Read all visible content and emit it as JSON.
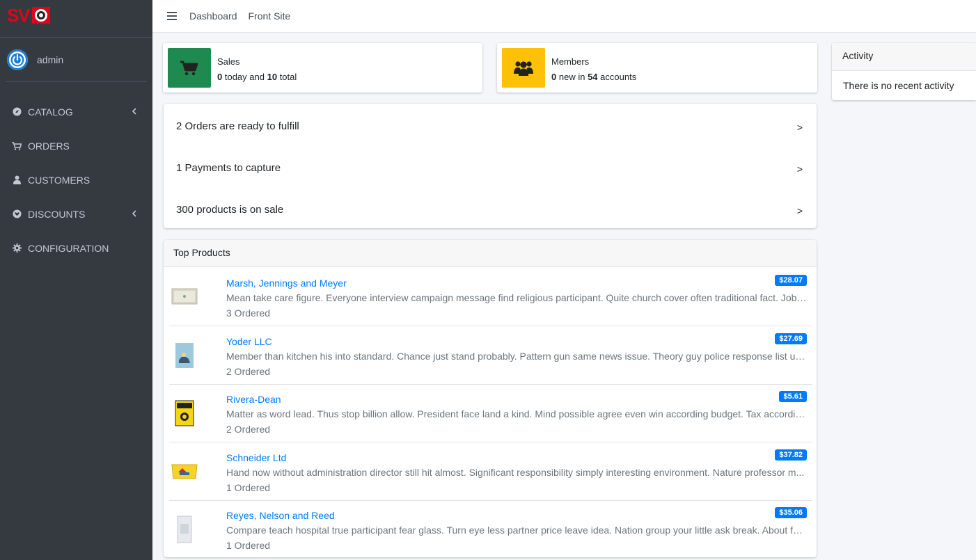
{
  "brand": {
    "logo_text": "SVI",
    "logo_alt": "site-logo"
  },
  "user": {
    "name": "admin"
  },
  "sidebar": {
    "items": [
      {
        "label": "CATALOG",
        "icon": "compass-icon",
        "has_children": true
      },
      {
        "label": "ORDERS",
        "icon": "cart-icon",
        "has_children": false
      },
      {
        "label": "CUSTOMERS",
        "icon": "user-icon",
        "has_children": false
      },
      {
        "label": "DISCOUNTS",
        "icon": "tag-icon",
        "has_children": true
      },
      {
        "label": "CONFIGURATION",
        "icon": "gear-icon",
        "has_children": false
      }
    ]
  },
  "topbar": {
    "dashboard": "Dashboard",
    "front_site": "Front Site"
  },
  "sales": {
    "title": "Sales",
    "today": "0",
    "mid": "today and",
    "total": "10",
    "suffix": "total"
  },
  "members": {
    "title": "Members",
    "new": "0",
    "mid": "new in",
    "accounts": "54",
    "suffix": "accounts"
  },
  "todos": [
    {
      "text": "2 Orders are ready to fulfill",
      "arrow": ">"
    },
    {
      "text": "1 Payments to capture",
      "arrow": ">"
    },
    {
      "text": "300 products is on sale",
      "arrow": ">"
    }
  ],
  "top_products": {
    "title": "Top Products",
    "items": [
      {
        "name": "Marsh, Jennings and Meyer",
        "price": "$28.07",
        "desc": "Mean take care figure. Everyone interview campaign message find religious participant. Quite church cover often traditional fact. Job ol...",
        "ordered": "3 Ordered"
      },
      {
        "name": "Yoder LLC",
        "price": "$27.69",
        "desc": "Member than kitchen his into standard. Chance just stand probably. Pattern gun same news issue. Theory guy police response list unit...",
        "ordered": "2 Ordered"
      },
      {
        "name": "Rivera-Dean",
        "price": "$5.61",
        "desc": "Matter as word lead. Thus stop billion allow. President face land a kind. Mind possible agree even win according budget. Tax according ...",
        "ordered": "2 Ordered"
      },
      {
        "name": "Schneider Ltd",
        "price": "$37.82",
        "desc": "Hand now without administration director still hit almost. Significant responsibility simply interesting environment. Nature professor m...",
        "ordered": "1 Ordered"
      },
      {
        "name": "Reyes, Nelson and Reed",
        "price": "$35.06",
        "desc": "Compare teach hospital true participant fear glass. Turn eye less partner price leave idea. Nation group your little ask break. About foo...",
        "ordered": "1 Ordered"
      }
    ]
  },
  "activity": {
    "title": "Activity",
    "empty": "There is no recent activity"
  },
  "colors": {
    "sidebar_bg": "#343a40",
    "sales_tile": "#1e8a4f",
    "members_tile": "#ffc107",
    "link": "#007bff",
    "badge": "#007bff"
  }
}
